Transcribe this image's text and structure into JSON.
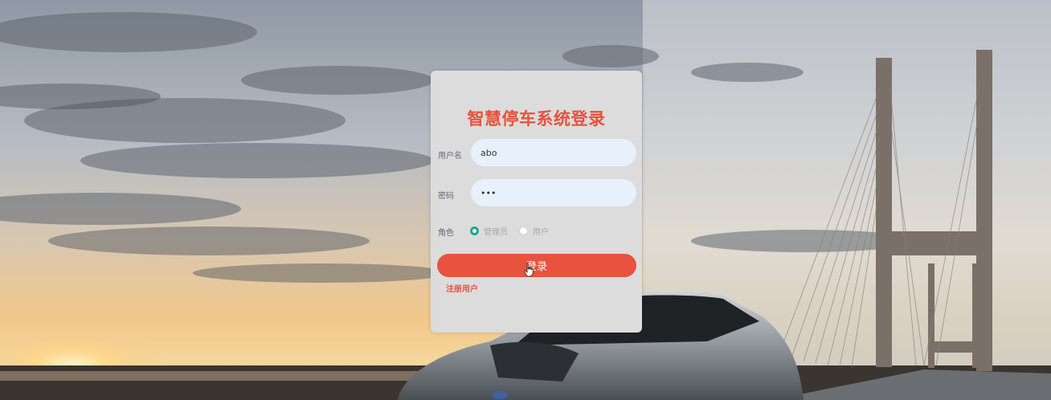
{
  "login": {
    "title": "智慧停车系统登录",
    "username_label": "用户名",
    "username_value": "abo",
    "password_label": "密码",
    "password_value": "abc",
    "role_label": "角色",
    "roles": [
      "管理员",
      "用户"
    ],
    "selected_role": "管理员",
    "submit_label": "登录",
    "register_link": "注册用户"
  },
  "colors": {
    "accent": "#e8523e",
    "radio_checked": "#1aaa8c",
    "input_bg": "#e8f0fb",
    "card_bg": "#dcdcdc"
  }
}
